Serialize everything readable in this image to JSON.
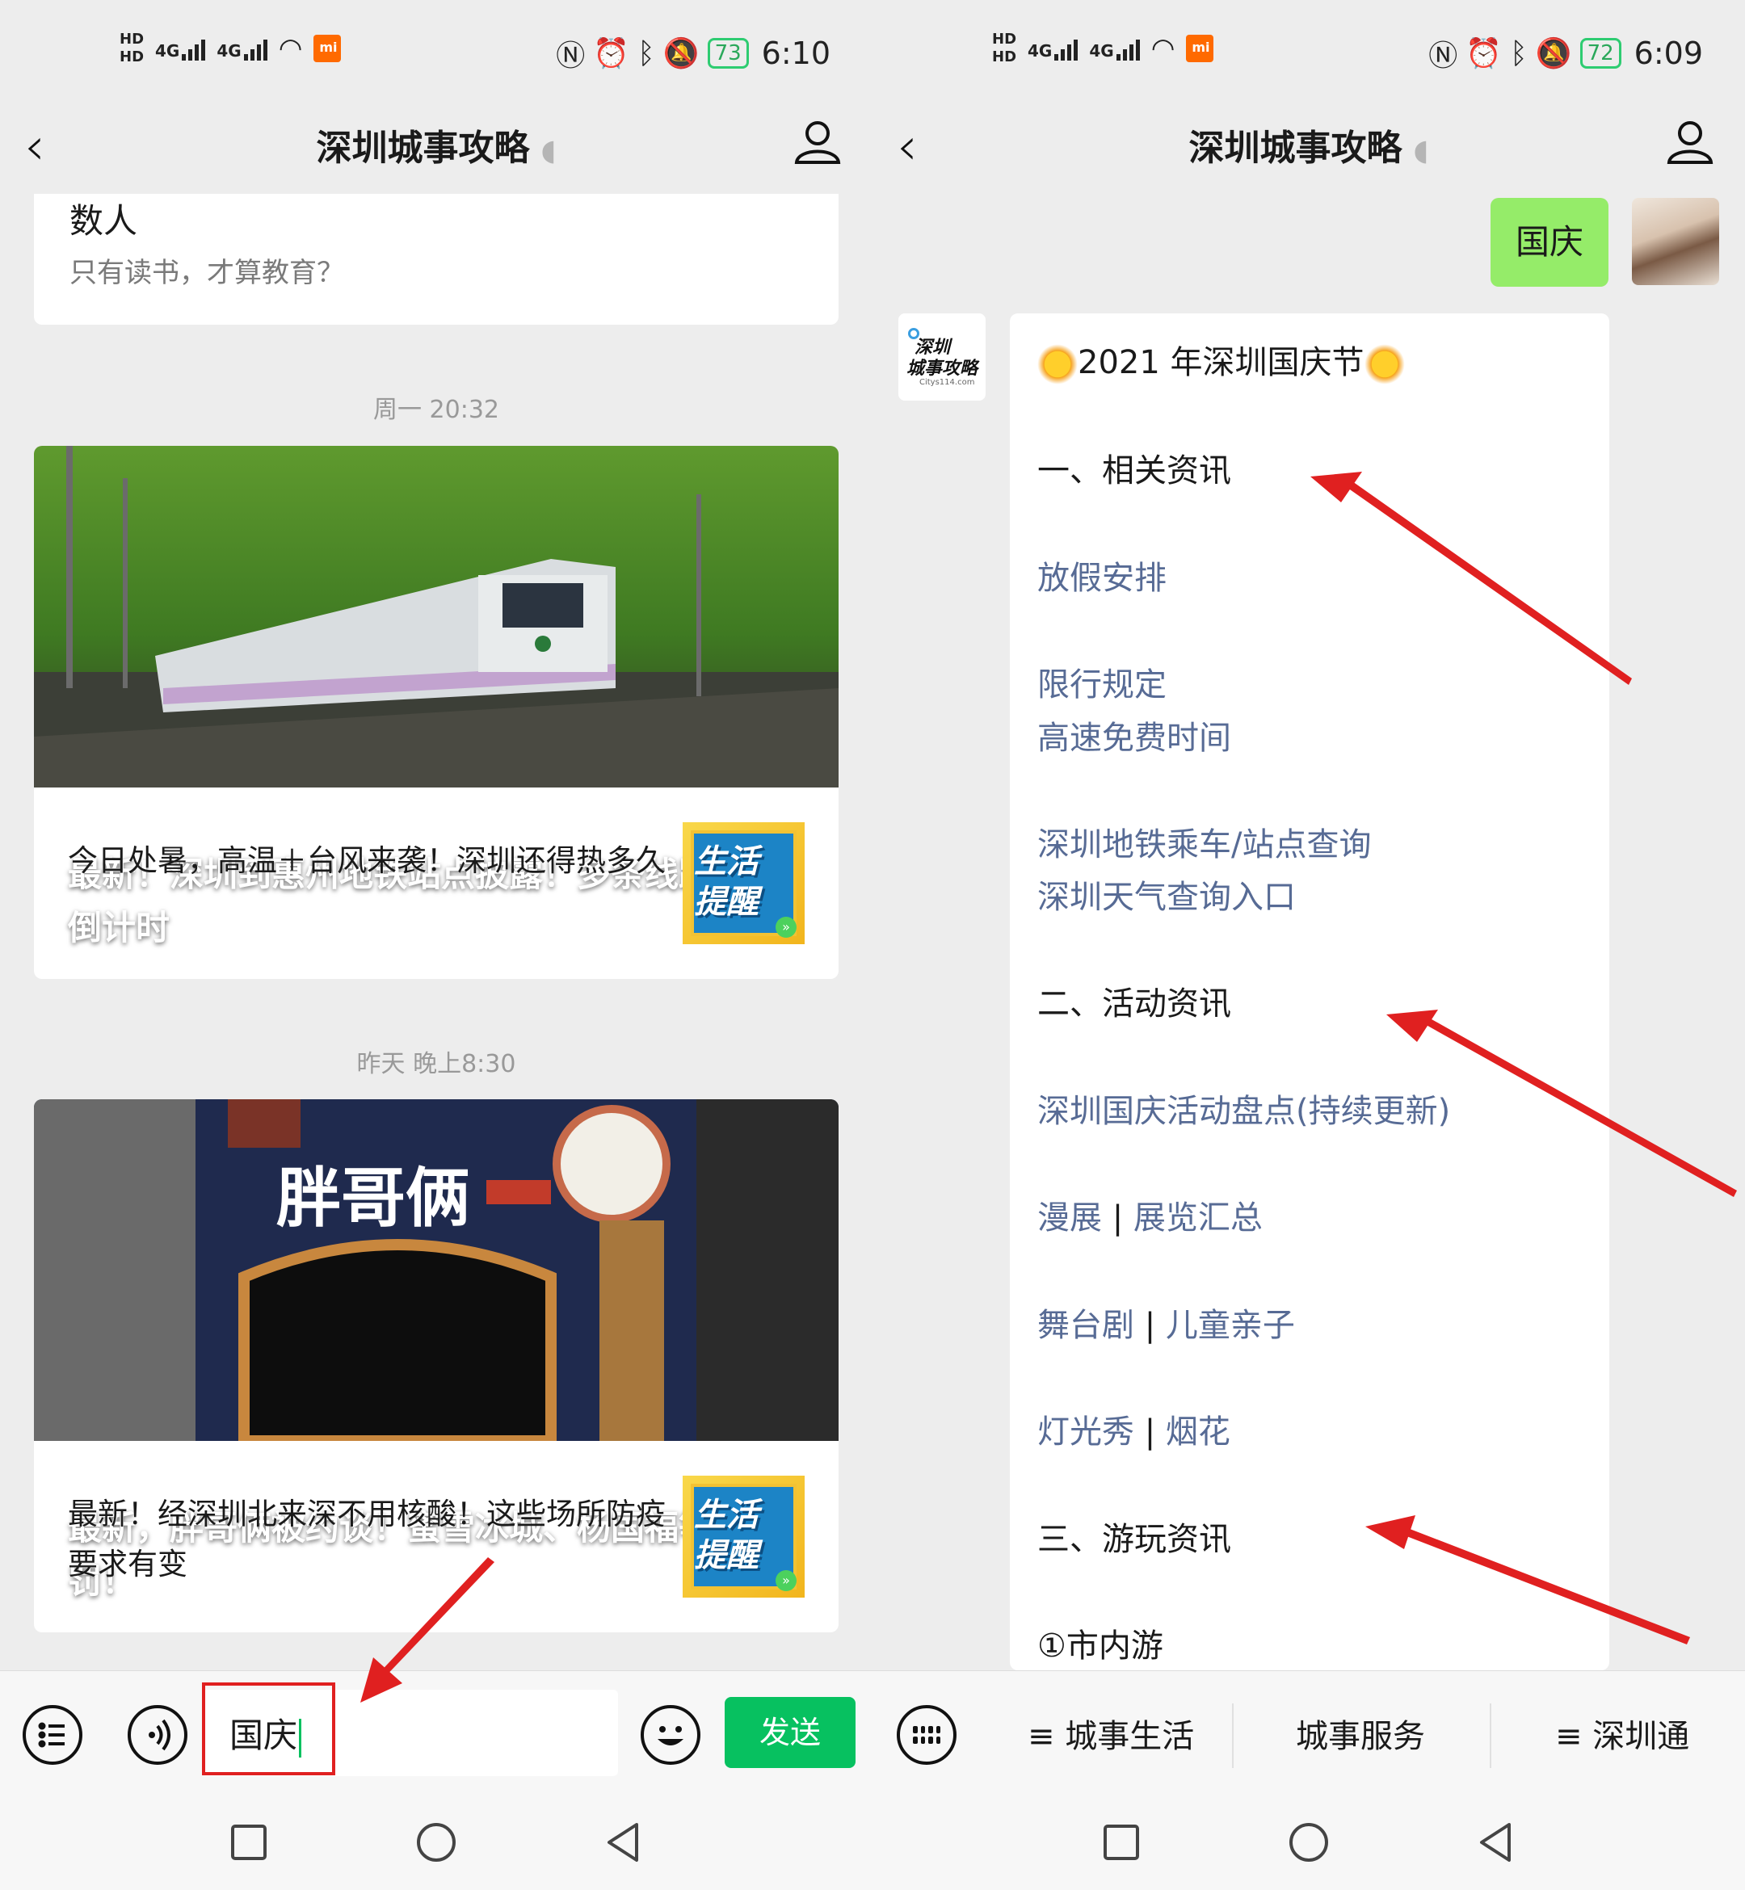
{
  "left": {
    "status": {
      "battery": "73",
      "time": "6:10",
      "net1": "4G",
      "net2": "4G",
      "hd1": "HD",
      "hd2": "HD"
    },
    "nav": {
      "title": "深圳城事攻略"
    },
    "top_card": {
      "title": "数人",
      "subtitle": "只有读书，才算教育？"
    },
    "timestamp1": "周一 20:32",
    "article1": {
      "title": "最新！深圳到惠州地铁站点披露！多条线路通车倒计时",
      "sub": "今日处暑，高温＋台风来袭！深圳还得热多久",
      "thumb_line1": "生活",
      "thumb_line2": "提醒"
    },
    "timestamp2": "昨天 晚上8:30",
    "article2": {
      "title": "最新，胖哥俩被约谈！蜜雪冰城、杨国福等受罚！",
      "sub": "最新！经深圳北来深不用核酸！这些场所防疫要求有变",
      "thumb_line1": "生活",
      "thumb_line2": "提醒",
      "sign_text": "胖哥俩"
    },
    "input": {
      "value": "国庆",
      "send_label": "发送"
    }
  },
  "right": {
    "status": {
      "battery": "72",
      "time": "6:09"
    },
    "nav": {
      "title": "深圳城事攻略"
    },
    "my_message": "国庆",
    "bot_avatar": {
      "line1": "深圳",
      "line2": "城事攻略",
      "line3": "Citys114.com"
    },
    "bot_message": {
      "title": "2021 年深圳国庆节",
      "section1": "一、相关资讯",
      "link1": "放假安排",
      "link2": "限行规定",
      "link3": "高速免费时间",
      "link4": "深圳地铁乘车/站点查询",
      "link5": "深圳天气查询入口",
      "section2": "二、活动资讯",
      "link6": "深圳国庆活动盘点(持续更新)",
      "link7a": "漫展",
      "link7b": "展览汇总",
      "link8a": "舞台剧",
      "link8b": "儿童亲子",
      "link9a": "灯光秀",
      "link9b": "烟花",
      "section3": "三、游玩资讯",
      "sub1": "①市内游",
      "divider": "|"
    },
    "menu": {
      "item1": "≡ 城事生活",
      "item2": "城事服务",
      "item3": "≡ 深圳通"
    }
  },
  "colors": {
    "wechat_green": "#07c160",
    "bubble_green": "#95ec69",
    "link_blue": "#576b95",
    "arrow_red": "#e02020",
    "bg": "#ededed"
  }
}
